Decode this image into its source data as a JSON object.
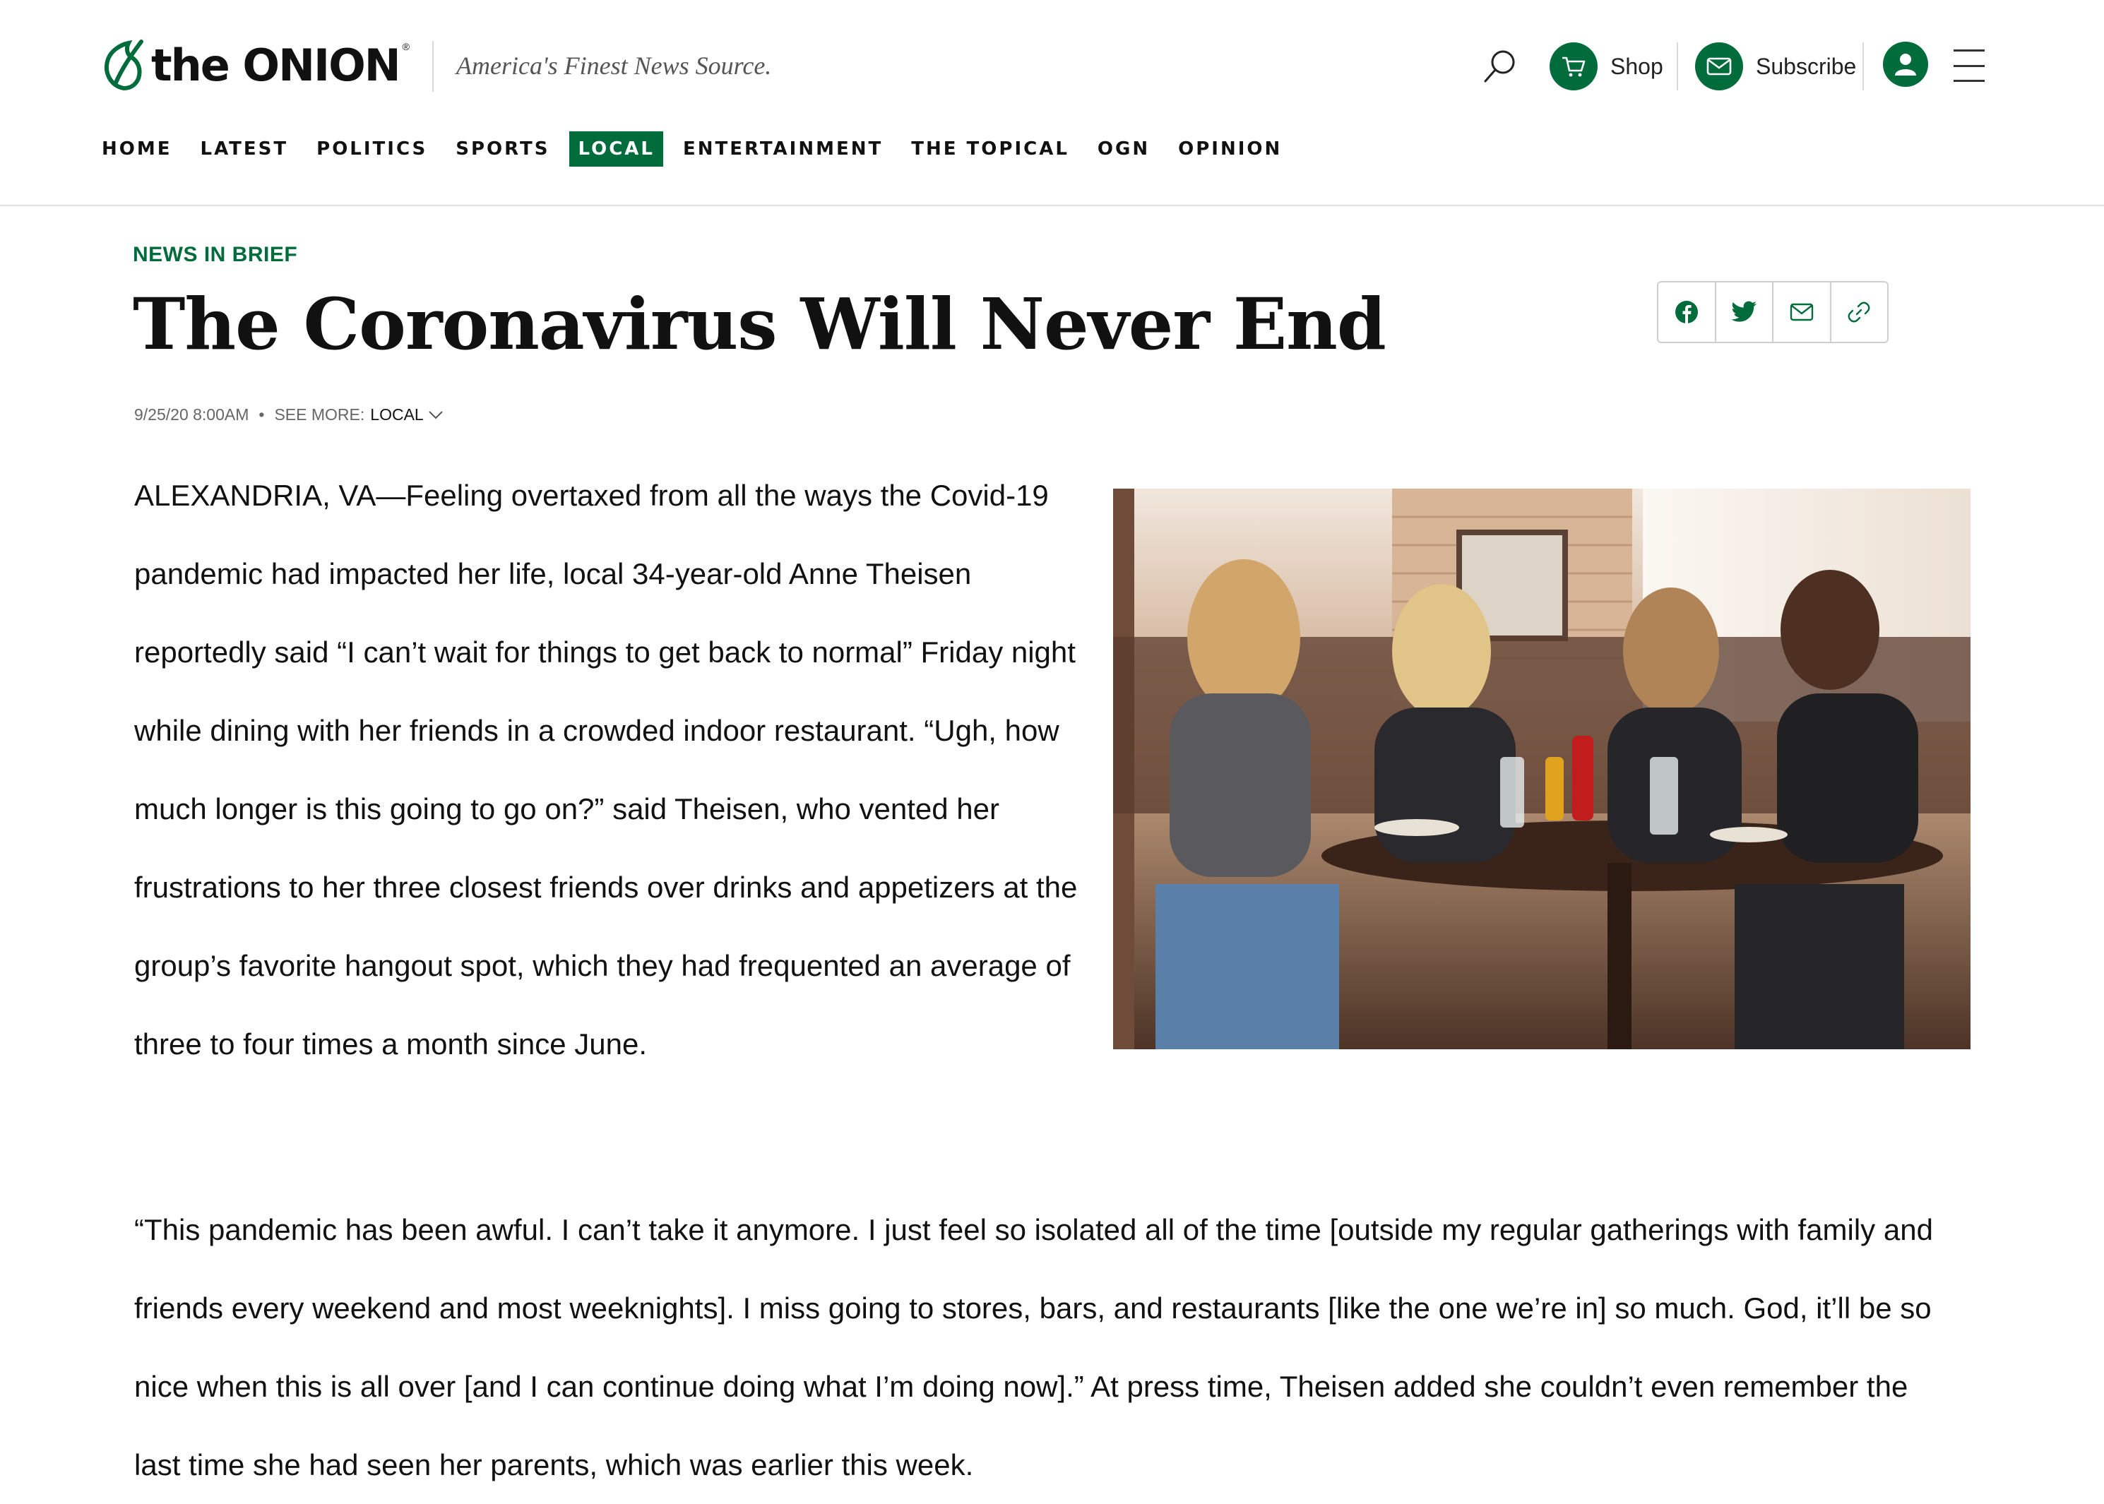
{
  "header": {
    "logo_text": "the ONION",
    "logo_reg": "®",
    "tagline": "America's Finest News Source.",
    "shop_label": "Shop",
    "subscribe_label": "Subscribe",
    "icons": [
      "search-icon",
      "cart-icon",
      "envelope-icon",
      "user-icon",
      "hamburger-menu-icon"
    ]
  },
  "nav": {
    "items": [
      "HOME",
      "LATEST",
      "POLITICS",
      "SPORTS",
      "LOCAL",
      "ENTERTAINMENT",
      "THE TOPICAL",
      "OGN",
      "OPINION"
    ],
    "active": "LOCAL"
  },
  "article": {
    "kicker": "NEWS IN BRIEF",
    "headline": "The Coronavirus Will Never End",
    "date": "9/25/20 8:00AM",
    "dot": "•",
    "see_more_label": "SEE MORE:",
    "see_more_value": "LOCAL",
    "paragraph1": "ALEXANDRIA, VA—Feeling overtaxed from all the ways the Covid-19 pandemic had impacted her life, local 34-year-old Anne Theisen reportedly said “I can’t wait for things to get back to normal” Friday night while dining with her friends in a crowded indoor restaurant. “Ugh, how much longer is this going to go on?” said Theisen, who vented her frustrations to her three closest friends over drinks and appetizers at the group’s favorite hangout spot, which they had frequented an average of three to four times a month since June.",
    "paragraph2": "“This pandemic has been awful. I can’t take it anymore. I just feel so isolated all of the time [outside my regular gatherings with family and friends every weekend and most weeknights]. I miss going to stores, bars, and restaurants [like the one we’re in] so much. God, it’ll be so nice when this is all over [and I can continue doing what I’m doing now].” At press time, Theisen added she couldn’t even remember the last time she had seen her parents, which was earlier this week."
  },
  "share_icons": [
    "facebook-icon",
    "twitter-icon",
    "email-icon",
    "link-icon"
  ],
  "colors": {
    "accent": "#006b3b",
    "text": "#111111",
    "muted": "#666666"
  }
}
